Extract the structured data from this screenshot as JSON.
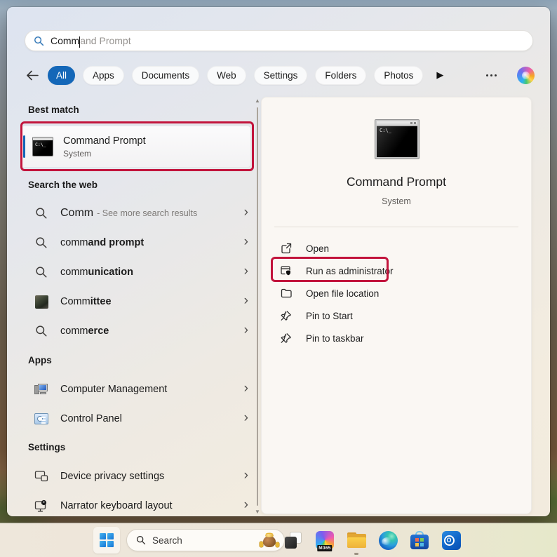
{
  "accent": {
    "selection_blue": "#1467b8",
    "annotation_red": "#c2143c"
  },
  "search_box": {
    "typed": "Comm",
    "completion": "and Prompt"
  },
  "filters": {
    "pills": [
      {
        "label": "All",
        "active": true
      },
      {
        "label": "Apps",
        "active": false
      },
      {
        "label": "Documents",
        "active": false
      },
      {
        "label": "Web",
        "active": false
      },
      {
        "label": "Settings",
        "active": false
      },
      {
        "label": "Folders",
        "active": false
      },
      {
        "label": "Photos",
        "active": false
      }
    ],
    "more_filters_glyph": "▶"
  },
  "left": {
    "best_match_heading": "Best match",
    "best_match": {
      "title": "Command Prompt",
      "subtitle": "System",
      "cmd_icon_text": "C:\\_"
    },
    "web_heading": "Search the web",
    "web_items": [
      {
        "typed": "Comm",
        "rest": "",
        "note": "- See more search results"
      },
      {
        "typed": "comm",
        "rest": "and prompt",
        "note": ""
      },
      {
        "typed": "comm",
        "rest": "unication",
        "note": ""
      },
      {
        "typed": "Comm",
        "rest": "ittee",
        "note": ""
      },
      {
        "typed": "comm",
        "rest": "erce",
        "note": ""
      }
    ],
    "apps_heading": "Apps",
    "app_items": [
      {
        "label": "Computer Management"
      },
      {
        "label": "Control Panel"
      }
    ],
    "settings_heading": "Settings",
    "settings_items": [
      {
        "label": "Device privacy settings"
      },
      {
        "label": "Narrator keyboard layout"
      }
    ],
    "chevron_glyph": "›",
    "scroll_up_glyph": "▲",
    "scroll_down_glyph": "▼"
  },
  "preview": {
    "title": "Command Prompt",
    "subtitle": "System",
    "cmd_icon_text": "C:\\_",
    "actions": [
      {
        "label": "Open"
      },
      {
        "label": "Run as administrator"
      },
      {
        "label": "Open file location"
      },
      {
        "label": "Pin to Start"
      },
      {
        "label": "Pin to taskbar"
      }
    ]
  },
  "taskbar": {
    "search_label": "Search",
    "m365_badge": "M365"
  }
}
